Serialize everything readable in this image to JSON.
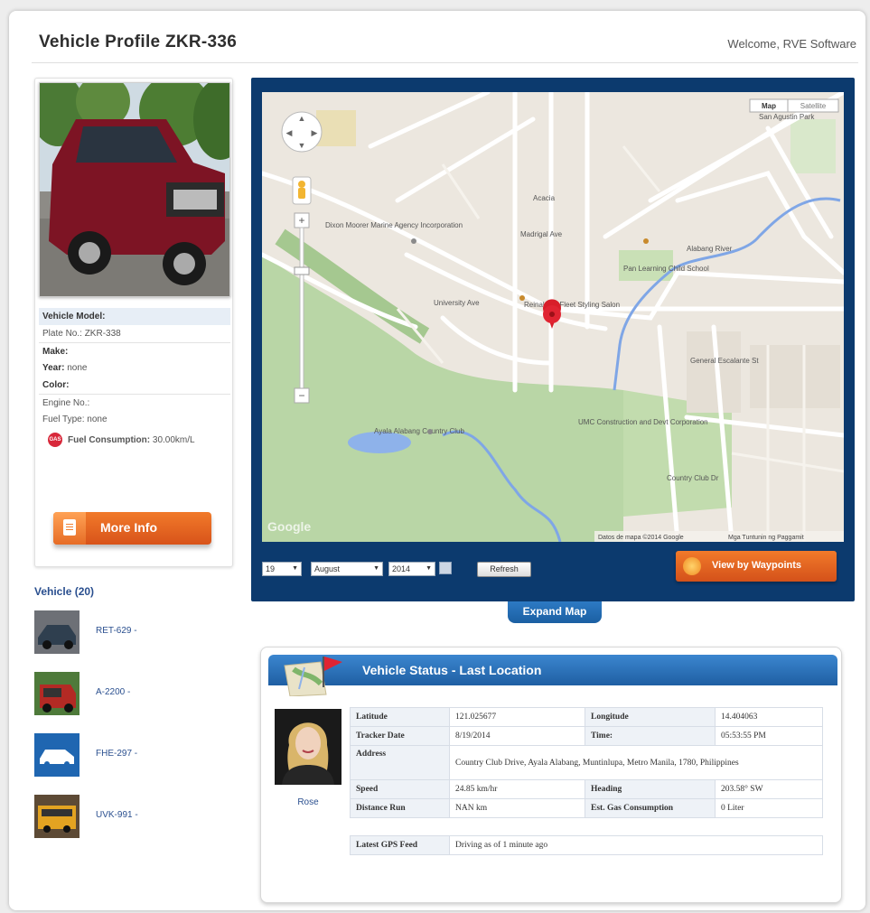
{
  "header": {
    "title": "Vehicle Profile ZKR-336",
    "welcome": "Welcome, RVE Software"
  },
  "vehicle": {
    "model_label": "Vehicle Model:",
    "plate_label": "Plate No.:",
    "plate_value": "ZKR-338",
    "make_label": "Make:",
    "year_label": "Year:",
    "year_value": "none",
    "color_label": "Color:",
    "engine_label": "Engine No.:",
    "fuel_type_label": "Fuel Type:",
    "fuel_type_value": "none",
    "fuel_consumption_label": "Fuel Consumption:",
    "fuel_consumption_value": "30.00km/L",
    "more_info_label": "More Info"
  },
  "vehicle_list": {
    "title": "Vehicle (20)",
    "items": [
      {
        "label": "RET-629 -"
      },
      {
        "label": "A-2200 -"
      },
      {
        "label": "FHE-297 -"
      },
      {
        "label": "UVK-991 -"
      }
    ]
  },
  "map": {
    "mode_map": "Map",
    "mode_satellite": "Satellite",
    "attribution": "Datos de mapa ©2014 Google",
    "terms": "Mga Tuntunin ng Paggamit",
    "google": "Google",
    "place_labels": [
      "Ayala Alabang Country Club",
      "Dixon Moorer Marine Agency Incorporation",
      "Reinaldo's Fleet Styling Salon",
      "Pan Learning Child School",
      "UMC Construction and Devt Corporation",
      "San Agustin Park",
      "University Ave",
      "Acacia",
      "Madrigal Ave",
      "Country Club Dr",
      "General Escalante St",
      "Alabang River"
    ]
  },
  "map_controls": {
    "day": "19",
    "month": "August",
    "year": "2014",
    "refresh_label": "Refresh",
    "waypoints_label": "View by Waypoints",
    "expand_label": "Expand Map"
  },
  "status": {
    "title": "Vehicle Status - Last Location",
    "driver_name": "Rose",
    "latitude_label": "Latitude",
    "latitude_value": "121.025677",
    "longitude_label": "Longitude",
    "longitude_value": "14.404063",
    "tracker_date_label": "Tracker Date",
    "tracker_date_value": "8/19/2014",
    "time_label": "Time:",
    "time_value": "05:53:55 PM",
    "address_label": "Address",
    "address_value": "Country Club Drive, Ayala Alabang, Muntinlupa, Metro Manila, 1780, Philippines",
    "speed_label": "Speed",
    "speed_value": "24.85 km/hr",
    "heading_label": "Heading",
    "heading_value": "203.58° SW",
    "distance_label": "Distance Run",
    "distance_value": "NAN km",
    "gas_label": "Est. Gas Consumption",
    "gas_value": "0 Liter",
    "gps_label": "Latest GPS Feed",
    "gps_value": "Driving as of 1 minute ago"
  },
  "colors": {
    "brand_blue": "#0c3a6e",
    "accent_orange": "#e5651f",
    "link_blue": "#2a4f8f"
  }
}
